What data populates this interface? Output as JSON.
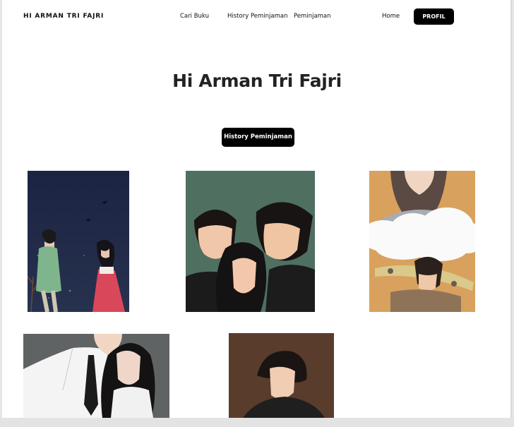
{
  "header": {
    "brand": "HI ARMAN TRI FAJRI",
    "nav": {
      "cari_buku": "Cari Buku",
      "history": "History Peminjaman",
      "peminjaman": "Peminjaman",
      "home": "Home"
    },
    "profil_button": "PROFIL"
  },
  "main": {
    "greeting": "Hi Arman Tri Fajri",
    "history_button": "History Peminjaman"
  },
  "books": [
    {
      "cover": "couple-night-sky-illustration"
    },
    {
      "cover": "couple-green-background-illustration"
    },
    {
      "cover": "girl-clouds-boy-skateboard-illustration"
    },
    {
      "cover": "couple-school-uniform-illustration"
    },
    {
      "cover": "boy-brown-background-illustration"
    }
  ],
  "colors": {
    "accent": "#000000",
    "page_bg": "#ffffff"
  }
}
